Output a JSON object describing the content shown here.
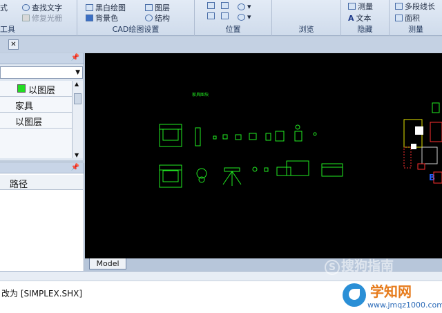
{
  "ribbon": {
    "groups": [
      {
        "caption": "工具",
        "items": [
          "式",
          "查找文字",
          "修复光栅"
        ]
      },
      {
        "caption": "CAD绘图设置",
        "items": [
          "黑白绘图",
          "背景色",
          "图层",
          "结构"
        ]
      },
      {
        "caption": "位置",
        "items": []
      },
      {
        "caption": "浏览",
        "items": []
      },
      {
        "caption": "隐藏",
        "items": [
          "测量",
          "文本"
        ]
      },
      {
        "caption": "测量",
        "items": [
          "多段线长",
          "面积"
        ]
      }
    ]
  },
  "panel_props": {
    "rows": [
      {
        "value": "以图层",
        "swatch_color": "#22dd22"
      },
      {
        "value": "家具"
      },
      {
        "value": "以图层"
      }
    ]
  },
  "panel_layers": {
    "column_header": "路径"
  },
  "canvas": {
    "background": "#000000",
    "accent": "#22ee22",
    "block_title": "家具图块"
  },
  "layout_tab": "Model",
  "command_line": {
    "text": "改为 [SIMPLEX.SHX]"
  },
  "watermarks": {
    "sogou": "搜狗指南",
    "site": "学知网",
    "url": "www.jmqz1000.com"
  }
}
